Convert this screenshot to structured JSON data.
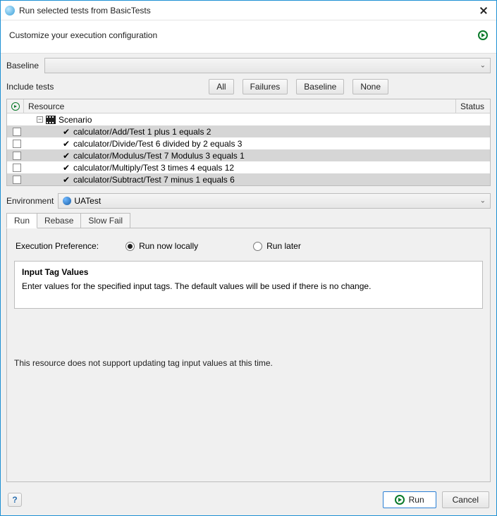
{
  "window": {
    "title": "Run selected tests from BasicTests"
  },
  "header": {
    "subtitle": "Customize your execution configuration"
  },
  "baseline": {
    "label": "Baseline",
    "selected": ""
  },
  "include": {
    "label": "Include tests",
    "buttons": {
      "all": "All",
      "failures": "Failures",
      "baseline": "Baseline",
      "none": "None"
    }
  },
  "tree": {
    "columns": {
      "resource": "Resource",
      "status": "Status"
    },
    "root": {
      "label": "Scenario"
    },
    "rows": [
      {
        "label": "calculator/Add/Test 1 plus 1 equals 2"
      },
      {
        "label": "calculator/Divide/Test 6 divided by  2 equals 3"
      },
      {
        "label": "calculator/Modulus/Test 7 Modulus 3 equals 1"
      },
      {
        "label": "calculator/Multiply/Test 3 times 4 equals 12"
      },
      {
        "label": "calculator/Subtract/Test 7 minus 1 equals 6"
      }
    ]
  },
  "environment": {
    "label": "Environment",
    "selected": "UATest"
  },
  "tabs": {
    "run": "Run",
    "rebase": "Rebase",
    "slowfail": "Slow Fail"
  },
  "pref": {
    "label": "Execution Preference:",
    "opt_now": "Run now locally",
    "opt_later": "Run later"
  },
  "tagbox": {
    "header": "Input Tag Values",
    "desc": "Enter values for the specified input tags. The default values will be used if there is no change."
  },
  "msg": "This resource does not support updating tag input values at this time.",
  "footer": {
    "run": "Run",
    "cancel": "Cancel"
  }
}
